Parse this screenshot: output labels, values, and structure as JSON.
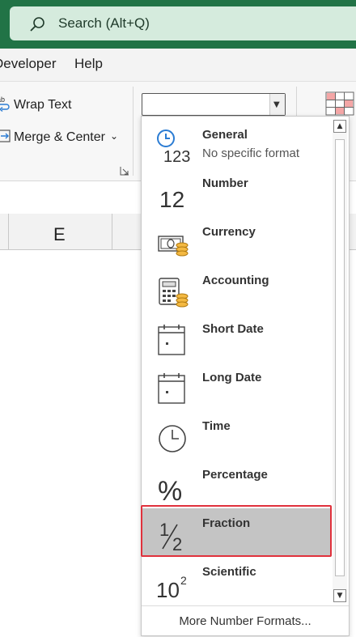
{
  "search": {
    "placeholder": "Search (Alt+Q)"
  },
  "tabs": [
    "Developer",
    "Help"
  ],
  "ribbon": {
    "wrap_text": "Wrap Text",
    "merge_center": "Merge & Center",
    "number_format_value": ""
  },
  "grid": {
    "column_label": "E"
  },
  "number_formats": [
    {
      "label": "General",
      "sub": "No specific format",
      "icon": "general-123-icon"
    },
    {
      "label": "Number",
      "icon": "number-12-icon"
    },
    {
      "label": "Currency",
      "icon": "currency-icon"
    },
    {
      "label": "Accounting",
      "icon": "accounting-calculator-icon"
    },
    {
      "label": "Short Date",
      "icon": "calendar-icon"
    },
    {
      "label": "Long Date",
      "icon": "calendar-icon"
    },
    {
      "label": "Time",
      "icon": "clock-icon"
    },
    {
      "label": "Percentage",
      "icon": "percent-icon"
    },
    {
      "label": "Fraction",
      "icon": "fraction-icon",
      "selected": true
    },
    {
      "label": "Scientific",
      "icon": "scientific-icon"
    }
  ],
  "more_formats": "More Number Formats...",
  "colors": {
    "excel_green": "#217346",
    "highlight": "#e0313c",
    "selected_bg": "#c4c4c4"
  }
}
